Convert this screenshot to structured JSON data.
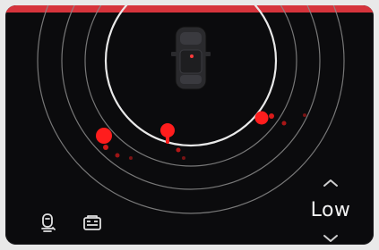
{
  "screen": {
    "top_accent_color": "#d6343c",
    "background_color": "#0b0b0d"
  },
  "radar": {
    "rings_color": "#ffffff",
    "car_icon": "car-top-view",
    "detections": [
      {
        "name": "left",
        "intensity": "high"
      },
      {
        "name": "center",
        "intensity": "high"
      },
      {
        "name": "right",
        "intensity": "high"
      }
    ],
    "detection_color": "#ff1d1d"
  },
  "controls": {
    "assist_icon": "driver-assist-icon",
    "camera_icon": "camera-view-icon",
    "up_icon": "chevron-up-icon",
    "down_icon": "chevron-down-icon",
    "level_value": "Low"
  }
}
